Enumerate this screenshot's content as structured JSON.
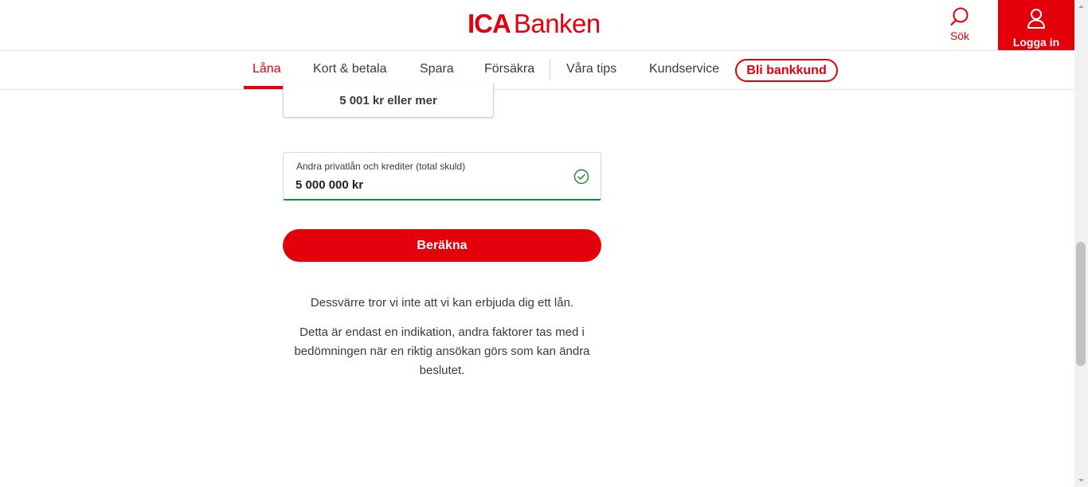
{
  "header": {
    "logo_brand": "ICA",
    "logo_name": "Banken",
    "search_label": "Sök",
    "login_label": "Logga in"
  },
  "nav": {
    "items": [
      {
        "label": "Låna",
        "active": true
      },
      {
        "label": "Kort & betala"
      },
      {
        "label": "Spara"
      },
      {
        "label": "Försäkra"
      },
      {
        "label": "Våra tips"
      },
      {
        "label": "Kundservice"
      }
    ],
    "cta_label": "Bli bankkund"
  },
  "form": {
    "option_label": "5 001 kr eller mer",
    "debt_field": {
      "label": "Andra privatlån och krediter (total skuld)",
      "value": "5 000 000 kr"
    },
    "submit_label": "Beräkna"
  },
  "result": {
    "message": "Dessvärre tror vi inte att vi kan erbjuda dig ett lån.",
    "disclaimer": "Detta är endast en indikation, andra faktorer tas med i bedömningen när en riktig ansökan görs som kan ändra beslutet."
  },
  "colors": {
    "brand": "#e3000b",
    "success": "#128a3c",
    "text": "#3a3a3a"
  },
  "icons": [
    "search-icon",
    "user-icon",
    "check-circle-icon"
  ]
}
